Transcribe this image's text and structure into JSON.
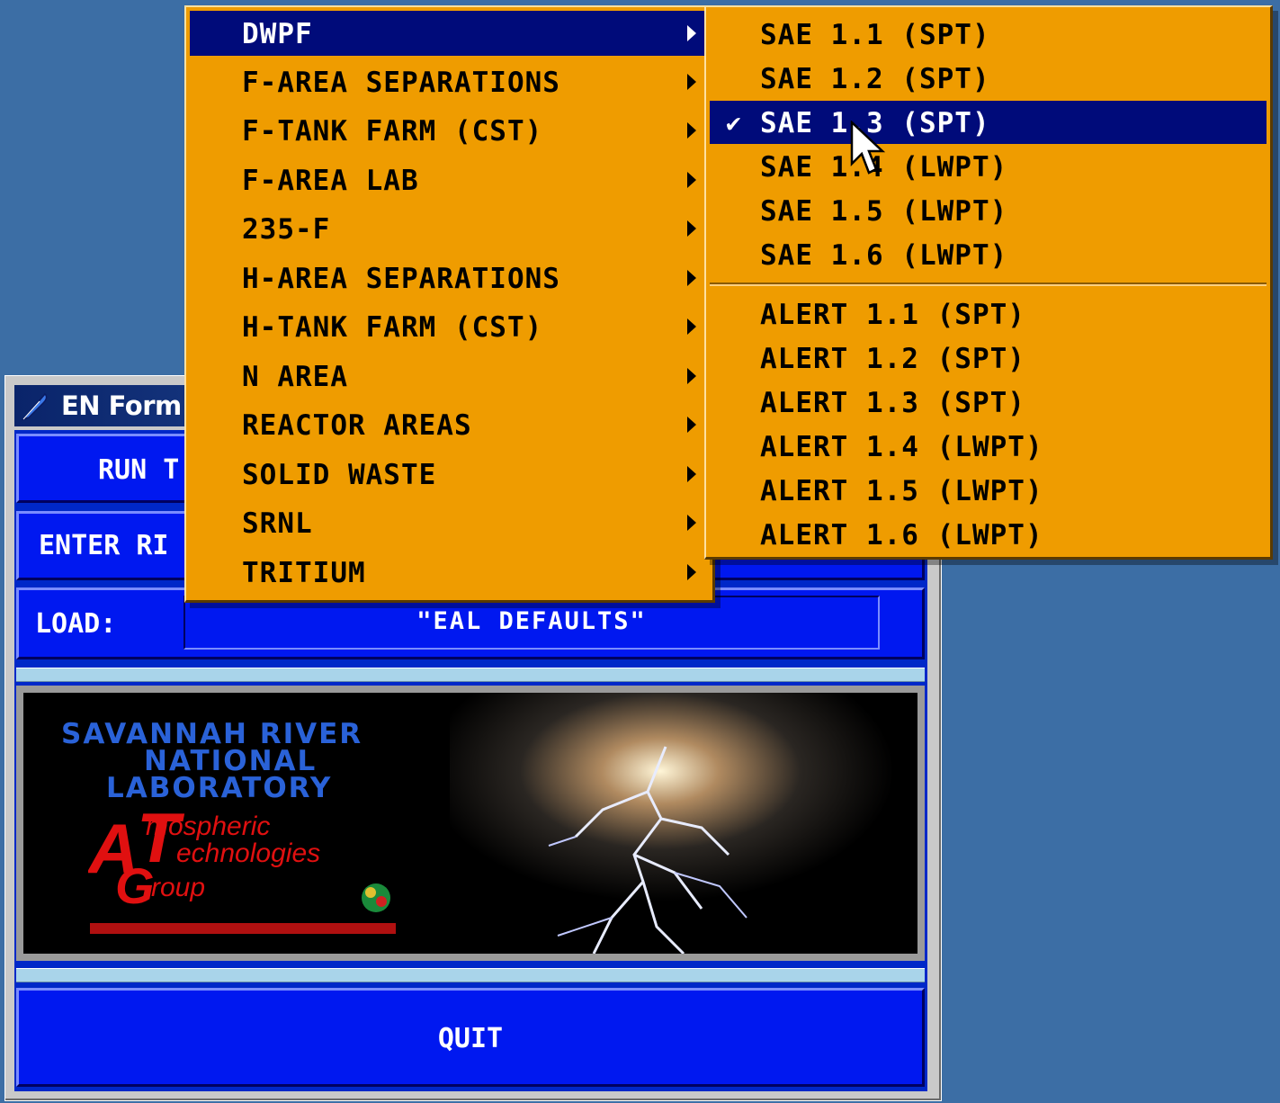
{
  "window": {
    "title": "EN Form:",
    "run_label": "RUN T",
    "enter_label": "ENTER RI",
    "load_label": "LOAD:",
    "load_value": "\"EAL DEFAULTS\"",
    "quit_label": "QUIT"
  },
  "logo": {
    "line1": "SAVANNAH RIVER",
    "line2": "NATIONAL",
    "line3": "LABORATORY",
    "group_line1": "Atmospheric",
    "group_line2": "Technologies",
    "group_line3": "Group"
  },
  "menu1": {
    "items": [
      {
        "label": "DWPF",
        "selected": true
      },
      {
        "label": "F-AREA SEPARATIONS"
      },
      {
        "label": "F-TANK FARM (CST)"
      },
      {
        "label": "F-AREA LAB"
      },
      {
        "label": "235-F"
      },
      {
        "label": "H-AREA SEPARATIONS"
      },
      {
        "label": "H-TANK FARM (CST)"
      },
      {
        "label": "N AREA"
      },
      {
        "label": "REACTOR AREAS"
      },
      {
        "label": "SOLID WASTE"
      },
      {
        "label": "SRNL"
      },
      {
        "label": "TRITIUM"
      }
    ]
  },
  "menu2": {
    "items": [
      {
        "label": "SAE 1.1 (SPT)"
      },
      {
        "label": "SAE 1.2 (SPT)"
      },
      {
        "label": "SAE 1.3 (SPT)",
        "selected": true,
        "checked": true
      },
      {
        "label": "SAE 1.4 (LWPT)"
      },
      {
        "label": "SAE 1.5 (LWPT)"
      },
      {
        "label": "SAE 1.6 (LWPT)"
      },
      {
        "label": "ALERT 1.1 (SPT)"
      },
      {
        "label": "ALERT 1.2 (SPT)"
      },
      {
        "label": "ALERT 1.3 (SPT)"
      },
      {
        "label": "ALERT 1.4 (LWPT)"
      },
      {
        "label": "ALERT 1.5 (LWPT)"
      },
      {
        "label": "ALERT 1.6 (LWPT)"
      }
    ],
    "check_glyph": "✔"
  },
  "colors": {
    "desktop": "#3c6ea5",
    "menu_bg": "#ef9c00",
    "menu_selected": "#000b7a",
    "panel_blue": "#0018f0"
  }
}
